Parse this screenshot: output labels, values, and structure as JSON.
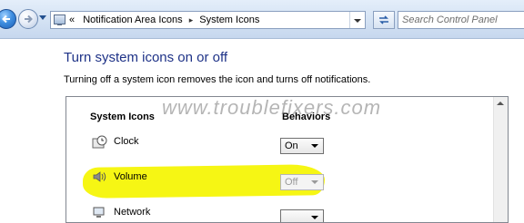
{
  "toolbar": {
    "breadcrumb": [
      "Notification Area Icons",
      "System Icons"
    ],
    "breadcrumb_prefix": "«",
    "breadcrumb_separator": "▸",
    "search_placeholder": "Search Control Panel"
  },
  "main": {
    "title": "Turn system icons on or off",
    "description": "Turning off a system icon removes the icon and turns off notifications.",
    "columns": {
      "icons": "System Icons",
      "behaviors": "Behaviors"
    },
    "rows": [
      {
        "icon": "clock-icon",
        "label": "Clock",
        "behavior": "On",
        "disabled": false
      },
      {
        "icon": "speaker-icon",
        "label": "Volume",
        "behavior": "Off",
        "disabled": true
      },
      {
        "icon": "network-icon",
        "label": "Network",
        "behavior": "",
        "disabled": false
      }
    ],
    "highlight_color": "#f5f500"
  },
  "watermark": "www.troublefixers.com",
  "colors": {
    "title": "#1e3287",
    "toolbar": "#d5e3f4"
  }
}
